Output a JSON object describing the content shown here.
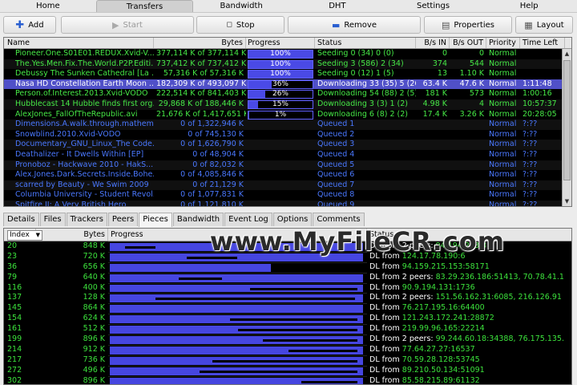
{
  "menu": [
    "Home",
    "Transfers",
    "Bandwidth",
    "DHT",
    "Settings",
    "Help"
  ],
  "menu_active": 1,
  "toolbar": {
    "add": "Add",
    "start": "Start",
    "stop": "Stop",
    "remove": "Remove",
    "properties": "Properties",
    "layout": "Layout"
  },
  "transfers": {
    "columns": [
      "Name",
      "Bytes",
      "Progress",
      "Status",
      "B/s IN",
      "B/s OUT",
      "Priority",
      "Time Left"
    ],
    "rows": [
      {
        "name": "Pioneer.One.S01E01.REDUX.Xvid-V...",
        "bytes": "377,114 K of 377,114 K",
        "progress": 100,
        "plabel": "100%",
        "status": "Seeding 0 (34) 0 (0)",
        "bin": "0",
        "bout": "0",
        "priority": "Normal",
        "time": "",
        "color": "#46e846"
      },
      {
        "name": "The.Yes.Men.Fix.The.World.P2P.Editi...",
        "bytes": "737,412 K of 737,412 K",
        "progress": 100,
        "plabel": "100%",
        "status": "Seeding 3 (586) 2 (34)",
        "bin": "374",
        "bout": "544",
        "priority": "Normal",
        "time": "",
        "color": "#46e846"
      },
      {
        "name": "Debussy The Sunken Cathedral [La ...",
        "bytes": "57,316 K of 57,316 K",
        "progress": 100,
        "plabel": "100%",
        "status": "Seeding 0 (12) 1 (5)",
        "bin": "13",
        "bout": "1.10 K",
        "priority": "Normal",
        "time": "",
        "color": "#46e846"
      },
      {
        "name": "Nasa HD Constellation Earth Moon ...",
        "bytes": "182,309 K of 493,097 K",
        "progress": 36,
        "plabel": "36%",
        "status": "Downloading 33 (35) 5 (26)",
        "bin": "63.4 K",
        "bout": "47.6 K",
        "priority": "Normal",
        "time": "1:11:48",
        "color": "#46e846",
        "selected": true
      },
      {
        "name": "Person.of.Interest.2013.Xvid-VODO",
        "bytes": "222,514 K of 841,403 K",
        "progress": 26,
        "plabel": "26%",
        "status": "Downloading 54 (88) 2 (5)",
        "bin": "181 K",
        "bout": "573",
        "priority": "Normal",
        "time": "1:00:16",
        "color": "#46e846"
      },
      {
        "name": "Hubblecast 14 Hubble finds first org...",
        "bytes": "29,868 K of 188,446 K",
        "progress": 15,
        "plabel": "15%",
        "status": "Downloading 3 (3) 1 (2)",
        "bin": "4.98 K",
        "bout": "4",
        "priority": "Normal",
        "time": "10:57:37",
        "color": "#46e846"
      },
      {
        "name": "AlexJones_FallOfTheRepublic.avi",
        "bytes": "21,676 K of 1,417,651 K",
        "progress": 1,
        "plabel": "1%",
        "status": "Downloading 6 (8) 2 (2)",
        "bin": "17.4 K",
        "bout": "3.26 K",
        "priority": "Normal",
        "time": "20:28:05",
        "color": "#46e846"
      },
      {
        "name": "Dimensions.A.walk.through.mathem...",
        "bytes": "0 of 1,322,946 K",
        "progress": 0,
        "plabel": "",
        "status": "Queued 1",
        "bin": "",
        "bout": "",
        "priority": "Normal",
        "time": "?:??",
        "color": "#4a78ff"
      },
      {
        "name": "Snowblind.2010.Xvid-VODO",
        "bytes": "0 of 745,130 K",
        "progress": 0,
        "plabel": "",
        "status": "Queued 2",
        "bin": "",
        "bout": "",
        "priority": "Normal",
        "time": "?:??",
        "color": "#4a78ff"
      },
      {
        "name": "Documentary_GNU_Linux_The Code...",
        "bytes": "0 of 1,626,790 K",
        "progress": 0,
        "plabel": "",
        "status": "Queued 3",
        "bin": "",
        "bout": "",
        "priority": "Normal",
        "time": "?:??",
        "color": "#4a78ff"
      },
      {
        "name": "Deathalizer - It Dwells Within [EP]",
        "bytes": "0 of 48,904 K",
        "progress": 0,
        "plabel": "",
        "status": "Queued 4",
        "bin": "",
        "bout": "",
        "priority": "Normal",
        "time": "?:??",
        "color": "#4a78ff"
      },
      {
        "name": "Pronoboz - Hackwave 2010 - HakS...",
        "bytes": "0 of 82,032 K",
        "progress": 0,
        "plabel": "",
        "status": "Queued 5",
        "bin": "",
        "bout": "",
        "priority": "Normal",
        "time": "?:??",
        "color": "#4a78ff"
      },
      {
        "name": "Alex.Jones.Dark.Secrets.Inside.Bohe...",
        "bytes": "0 of 4,085,846 K",
        "progress": 0,
        "plabel": "",
        "status": "Queued 6",
        "bin": "",
        "bout": "",
        "priority": "Normal",
        "time": "?:??",
        "color": "#4a78ff"
      },
      {
        "name": "scarred by Beauty - We Swim 2009",
        "bytes": "0 of 21,129 K",
        "progress": 0,
        "plabel": "",
        "status": "Queued 7",
        "bin": "",
        "bout": "",
        "priority": "Normal",
        "time": "?:??",
        "color": "#4a78ff"
      },
      {
        "name": "Columbia University - Student Revol...",
        "bytes": "0 of 1,077,831 K",
        "progress": 0,
        "plabel": "",
        "status": "Queued 8",
        "bin": "",
        "bout": "",
        "priority": "Normal",
        "time": "?:??",
        "color": "#4a78ff"
      },
      {
        "name": "Spitfire II: A Very British Hero",
        "bytes": "0 of 1,121,810 K",
        "progress": 0,
        "plabel": "",
        "status": "Queued 9",
        "bin": "",
        "bout": "",
        "priority": "Normal",
        "time": "?:??",
        "color": "#4a78ff"
      }
    ]
  },
  "tabs": [
    "Details",
    "Files",
    "Trackers",
    "Peers",
    "Pieces",
    "Bandwidth",
    "Event Log",
    "Options",
    "Comments"
  ],
  "tab_active": 4,
  "pieces": {
    "sort_select": "Index",
    "columns": [
      "Bytes",
      "Progress",
      "Status"
    ],
    "rows": [
      {
        "index": "20",
        "bytes": "848 K",
        "fill": 99,
        "gap": [
          6,
          18
        ],
        "status_text": "DL from 2 peers:",
        "peer": "94.194.203.3"
      },
      {
        "index": "23",
        "bytes": "720 K",
        "fill": 99,
        "gap": [
          30,
          50
        ],
        "status_text": "DL from",
        "peer": "124.17.78.190:6"
      },
      {
        "index": "36",
        "bytes": "656 K",
        "fill": 63,
        "gap": [],
        "status_text": "DL from",
        "peer": "94.159.215.153:58171"
      },
      {
        "index": "79",
        "bytes": "640 K",
        "fill": 99,
        "gap": [
          27,
          44
        ],
        "status_text": "DL from 2 peers:",
        "peer": "83.29.236.186:51413, 70.78.41.1"
      },
      {
        "index": "116",
        "bytes": "400 K",
        "fill": 99,
        "gap": [
          55,
          97
        ],
        "status_text": "DL from",
        "peer": "90.9.194.131:1736"
      },
      {
        "index": "137",
        "bytes": "128 K",
        "fill": 99,
        "gap": [
          18,
          96
        ],
        "status_text": "DL from 2 peers:",
        "peer": "151.56.162.31:6085, 216.126.91"
      },
      {
        "index": "145",
        "bytes": "864 K",
        "fill": 99,
        "gap": [],
        "status_text": "DL from",
        "peer": "76.217.195.16:64400"
      },
      {
        "index": "154",
        "bytes": "624 K",
        "fill": 99,
        "gap": [
          47,
          97
        ],
        "status_text": "DL from",
        "peer": "121.243.172.241:28872"
      },
      {
        "index": "161",
        "bytes": "512 K",
        "fill": 99,
        "gap": [
          50,
          97
        ],
        "status_text": "DL from",
        "peer": "219.99.96.165:22214"
      },
      {
        "index": "199",
        "bytes": "896 K",
        "fill": 99,
        "gap": [
          60,
          97
        ],
        "status_text": "DL from 2 peers:",
        "peer": "99.244.60.18:34388, 76.175.135."
      },
      {
        "index": "214",
        "bytes": "912 K",
        "fill": 99,
        "gap": [
          70,
          97
        ],
        "status_text": "DL from",
        "peer": "77.64.27.27:16537"
      },
      {
        "index": "217",
        "bytes": "736 K",
        "fill": 99,
        "gap": [
          40,
          97
        ],
        "status_text": "DL from",
        "peer": "70.59.28.128:53745"
      },
      {
        "index": "272",
        "bytes": "496 K",
        "fill": 99,
        "gap": [
          35,
          97
        ],
        "status_text": "DL from",
        "peer": "89.210.50.134:51091"
      },
      {
        "index": "302",
        "bytes": "896 K",
        "fill": 99,
        "gap": [
          75,
          97
        ],
        "status_text": "DL from",
        "peer": "85.58.215.89:61132"
      }
    ]
  },
  "watermark": "www.MyFileCR.com",
  "colors": {
    "seeding": "#46e846",
    "queued": "#4a78ff",
    "selected_row": "#5050c8",
    "progress_fill": "#4646e0"
  }
}
